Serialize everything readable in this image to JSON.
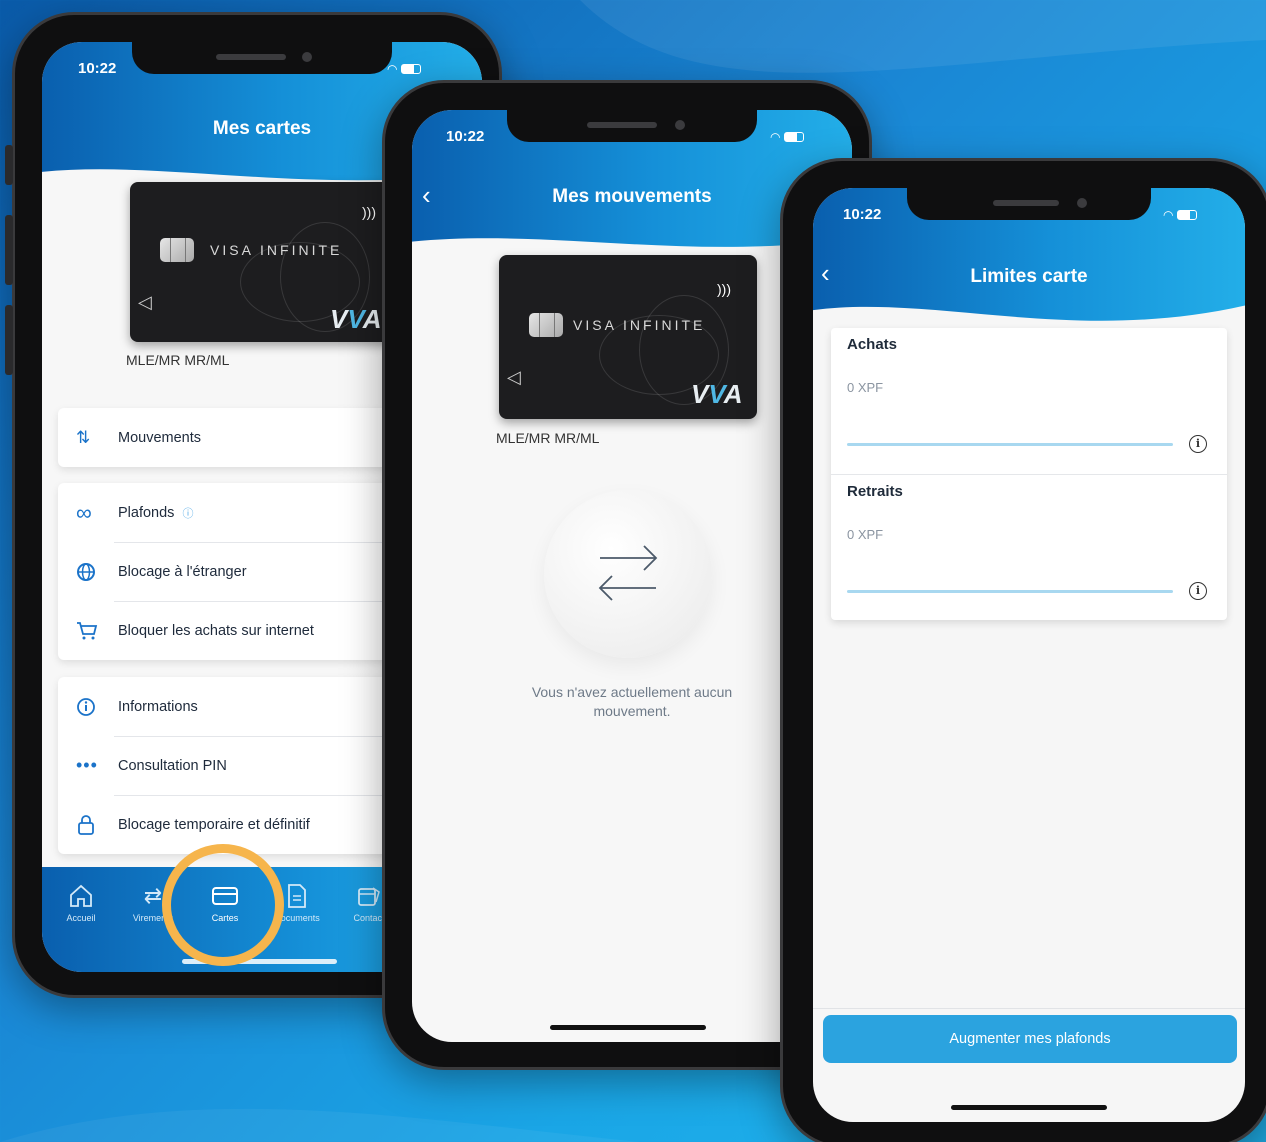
{
  "status": {
    "time": "10:22"
  },
  "colors": {
    "header_start": "#0a5fae",
    "header_end": "#23aee8",
    "highlight_ring": "#f6b54c",
    "cta": "#2ba3df",
    "icon_blue": "#1b73c9"
  },
  "card": {
    "brand": "VISA INFINITE",
    "holder": "MLE/MR MR/ML",
    "holder_alt": "MLE/MR MR/ML"
  },
  "screen_cards": {
    "title": "Mes cartes",
    "group1": [
      {
        "label": "Mouvements",
        "icon": "arrows-updown-icon"
      }
    ],
    "group2": [
      {
        "label": "Plafonds",
        "icon": "infinity-icon"
      },
      {
        "label": "Blocage à l'étranger",
        "icon": "globe-icon"
      },
      {
        "label": "Bloquer les achats sur internet",
        "icon": "cart-icon"
      }
    ],
    "group3": [
      {
        "label": "Informations",
        "icon": "info-icon"
      },
      {
        "label": "Consultation PIN",
        "icon": "dots-icon"
      },
      {
        "label": "Blocage temporaire et définitif",
        "icon": "lock-icon"
      }
    ],
    "tabs": [
      {
        "label": "Accueil",
        "icon": "home-icon"
      },
      {
        "label": "Virements",
        "icon": "transfer-icon"
      },
      {
        "label": "Cartes",
        "icon": "card-icon",
        "active": true
      },
      {
        "label": "Documents",
        "icon": "document-icon"
      },
      {
        "label": "Contact",
        "icon": "contact-icon"
      }
    ]
  },
  "screen_movements": {
    "title": "Mes mouvements",
    "empty_line1": "Vous n'avez actuellement aucun",
    "empty_line2": "mouvement."
  },
  "screen_limits": {
    "title": "Limites carte",
    "purchases_label": "Achats",
    "purchases_value": "0 XPF",
    "withdrawals_label": "Retraits",
    "withdrawals_value": "0 XPF",
    "cta": "Augmenter mes plafonds"
  }
}
